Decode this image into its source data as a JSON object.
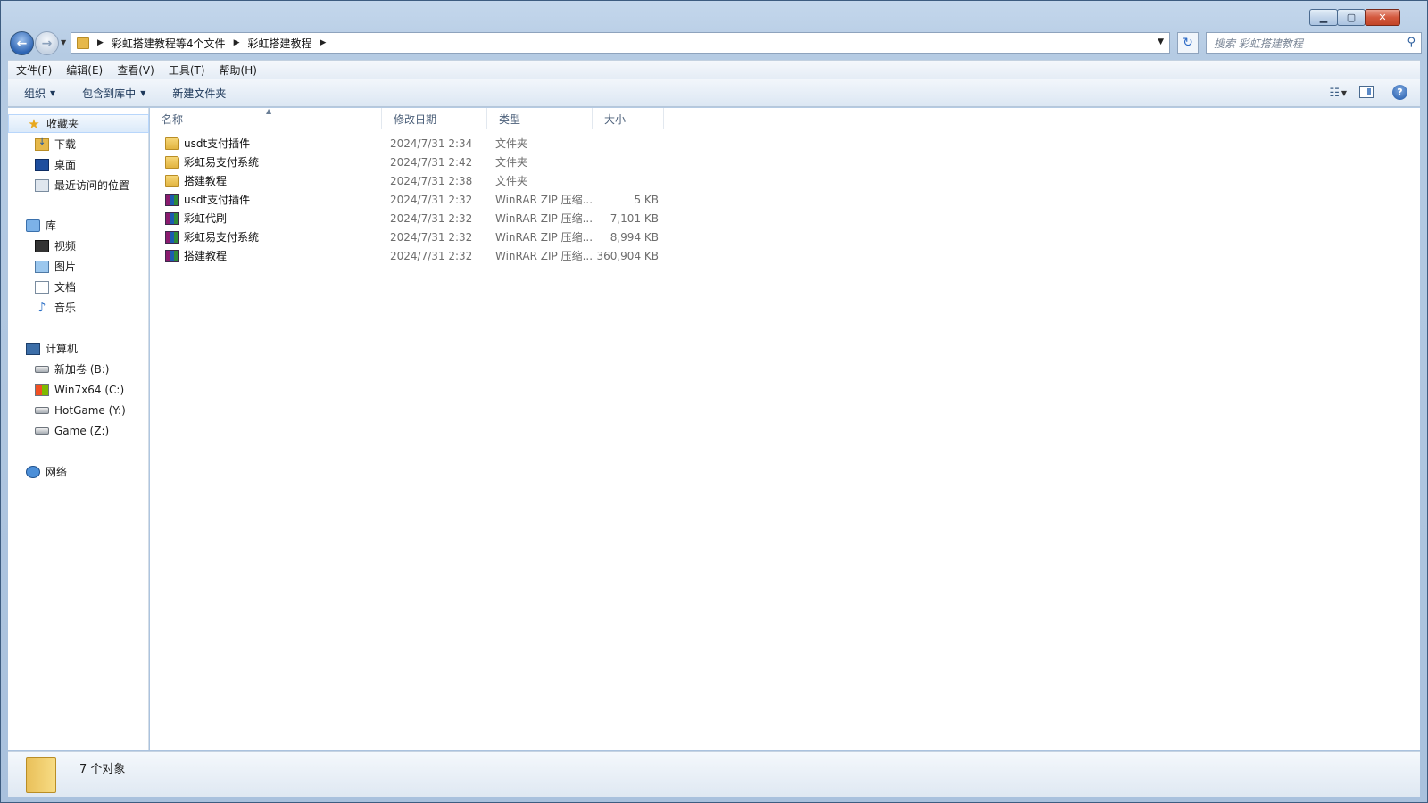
{
  "window": {
    "caption_buttons": [
      "minimize",
      "maximize",
      "close"
    ]
  },
  "navigation": {
    "breadcrumbs": [
      "彩虹搭建教程等4个文件",
      "彩虹搭建教程"
    ],
    "search_placeholder": "搜索 彩虹搭建教程"
  },
  "menubar": {
    "items": [
      "文件(F)",
      "编辑(E)",
      "查看(V)",
      "工具(T)",
      "帮助(H)"
    ]
  },
  "commandbar": {
    "organize": "组织",
    "include_library": "包含到库中",
    "new_folder": "新建文件夹"
  },
  "sidebar": {
    "favorites": {
      "label": "收藏夹",
      "items": [
        {
          "label": "下载",
          "icon": "download-folder-icon"
        },
        {
          "label": "桌面",
          "icon": "desktop-icon"
        },
        {
          "label": "最近访问的位置",
          "icon": "recent-places-icon"
        }
      ]
    },
    "libraries": {
      "label": "库",
      "items": [
        {
          "label": "视频",
          "icon": "video-library-icon"
        },
        {
          "label": "图片",
          "icon": "picture-library-icon"
        },
        {
          "label": "文档",
          "icon": "document-library-icon"
        },
        {
          "label": "音乐",
          "icon": "music-library-icon"
        }
      ]
    },
    "computer": {
      "label": "计算机",
      "items": [
        {
          "label": "新加卷 (B:)",
          "icon": "drive-icon"
        },
        {
          "label": "Win7x64 (C:)",
          "icon": "windows-drive-icon"
        },
        {
          "label": "HotGame (Y:)",
          "icon": "drive-icon"
        },
        {
          "label": "Game (Z:)",
          "icon": "drive-icon"
        }
      ]
    },
    "network": {
      "label": "网络"
    }
  },
  "filelist": {
    "columns": [
      "名称",
      "修改日期",
      "类型",
      "大小"
    ],
    "rows": [
      {
        "name": "usdt支付插件",
        "date": "2024/7/31 2:34",
        "type": "文件夹",
        "size": "",
        "icon": "folder"
      },
      {
        "name": "彩虹易支付系统",
        "date": "2024/7/31 2:42",
        "type": "文件夹",
        "size": "",
        "icon": "folder"
      },
      {
        "name": "搭建教程",
        "date": "2024/7/31 2:38",
        "type": "文件夹",
        "size": "",
        "icon": "folder"
      },
      {
        "name": "usdt支付插件",
        "date": "2024/7/31 2:32",
        "type": "WinRAR ZIP 压缩...",
        "size": "5 KB",
        "icon": "rar"
      },
      {
        "name": "彩虹代刷",
        "date": "2024/7/31 2:32",
        "type": "WinRAR ZIP 压缩...",
        "size": "7,101 KB",
        "icon": "rar"
      },
      {
        "name": "彩虹易支付系统",
        "date": "2024/7/31 2:32",
        "type": "WinRAR ZIP 压缩...",
        "size": "8,994 KB",
        "icon": "rar"
      },
      {
        "name": "搭建教程",
        "date": "2024/7/31 2:32",
        "type": "WinRAR ZIP 压缩...",
        "size": "360,904 KB",
        "icon": "rar"
      }
    ]
  },
  "details": {
    "count_text": "7 个对象"
  }
}
